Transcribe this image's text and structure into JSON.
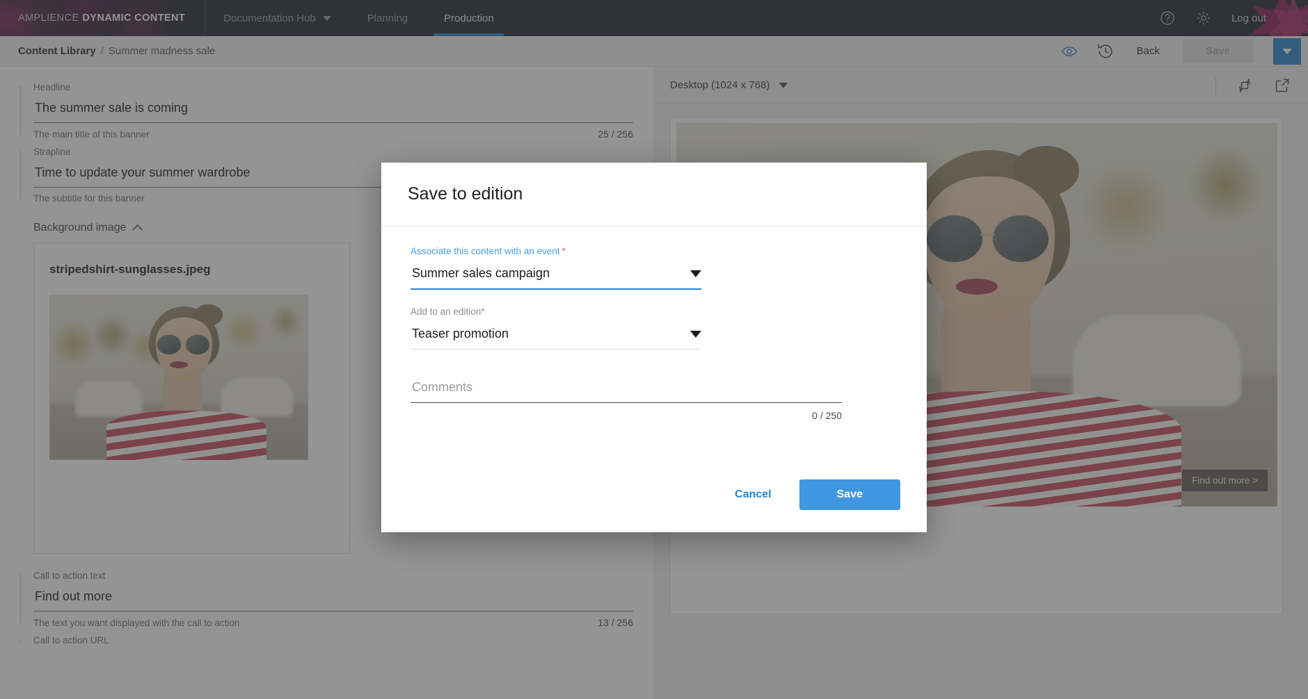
{
  "topnav": {
    "brand_light": "AMPLIENCE",
    "brand_bold": "DYNAMIC CONTENT",
    "items": [
      {
        "label": "Documentation Hub",
        "has_caret": true,
        "active": false
      },
      {
        "label": "Planning",
        "has_caret": false,
        "active": false
      },
      {
        "label": "Production",
        "has_caret": false,
        "active": true
      }
    ],
    "help_icon": "help-circle-icon",
    "settings_icon": "gear-icon",
    "logout_label": "Log out"
  },
  "subheader": {
    "breadcrumb_root": "Content Library",
    "breadcrumb_sep": "/",
    "breadcrumb_leaf": "Summer madness sale",
    "preview_icon": "eye-icon",
    "history_icon": "history-clock-icon",
    "back_label": "Back",
    "save_label": "Save",
    "save_dropdown_icon": "chevron-down-icon"
  },
  "form": {
    "fields": [
      {
        "label": "Headline",
        "value": "The summer sale is coming",
        "help": "The main title of this banner",
        "count": "25 / 256"
      },
      {
        "label": "Strapline",
        "value": "Time to update your summer wardrobe",
        "help": "The subtitle for this banner",
        "count": ""
      }
    ],
    "background_section": {
      "title": "Background image",
      "collapse_icon": "chevron-up-icon",
      "file_name": "stripedshirt-sunglasses.jpeg"
    },
    "cta_fields": [
      {
        "label": "Call to action text",
        "value": "Find out more",
        "help": "The text you want displayed with the call to action",
        "count": "13 / 256"
      }
    ],
    "cta_url_label": "Call to action URL"
  },
  "preview": {
    "device_label": "Desktop (1024 x 768)",
    "device_caret_icon": "chevron-down-icon",
    "rotate_icon": "rotate-device-icon",
    "popout_icon": "open-external-icon",
    "cta_badge": "Find out more >"
  },
  "modal": {
    "title": "Save to edition",
    "event_field": {
      "label": "Associate this content with an event",
      "required_mark": "*",
      "value": "Summer sales campaign",
      "caret_icon": "chevron-down-icon"
    },
    "edition_field": {
      "label": "Add to an edition",
      "required_mark": "*",
      "value": "Teaser promotion",
      "caret_icon": "chevron-down-icon"
    },
    "comments_field": {
      "placeholder": "Comments",
      "value": "",
      "count": "0 / 250"
    },
    "cancel_label": "Cancel",
    "save_label": "Save"
  },
  "colors": {
    "nav_bg": "#232730",
    "accent_blue": "#2a84d2",
    "button_blue": "#3f97e2",
    "required_red": "#e2574c",
    "brand_magenta": "#b0287a"
  }
}
